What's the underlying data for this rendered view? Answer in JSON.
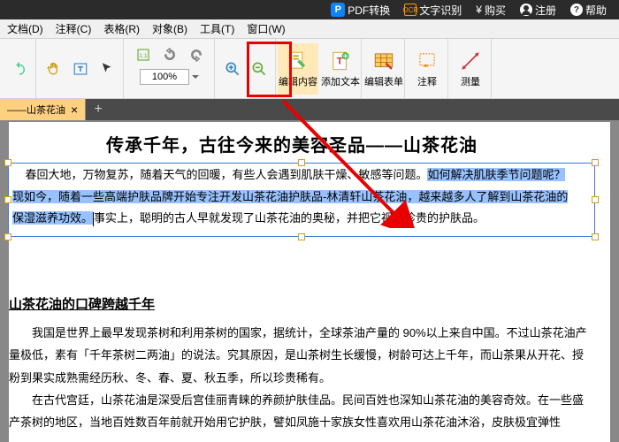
{
  "titlebar": {
    "pdf_convert": "PDF转换",
    "ocr": "文字识别",
    "buy": "购买",
    "register": "注册",
    "help": "帮助"
  },
  "menu": {
    "file": "文档(D)",
    "annotate": "注释(C)",
    "table": "表格(R)",
    "object": "对象(B)",
    "tool": "工具(T)",
    "window": "窗口(W)"
  },
  "toolbar": {
    "zoom": "100%",
    "edit_content": "编辑内容",
    "add_text": "添加文本",
    "edit_form": "编辑表单",
    "annotate": "注释",
    "measure": "测量"
  },
  "tab": {
    "name": "——山茶花油",
    "add": "+"
  },
  "doc": {
    "title": "传承千年，古往今来的美容圣品——山茶花油",
    "p1_a": "春回大地，万物复苏，随着天气的回暖，有些人会遇到肌肤干燥、敏感等问题。",
    "p1_q": "如何解决肌肤季节问题呢？",
    "p1_b": "现如今，随着一些高端护肤品牌开始专注开发山茶花油护肤品-林清轩山茶花油，越来越多人了解到山茶花油的",
    "p1_c": "保湿滋养功效。",
    "p1_d": "事实上，聪明的古人早就发现了山茶花油的奥秘，并把它视为珍贵的护肤品。",
    "h2": "山茶花油的口碑跨越千年",
    "p2": "我国是世界上最早发现茶树和利用茶树的国家，据统计，全球茶油产量的 90%以上来自中国。不过山茶花油产量极低，素有「千年茶树二两油」的说法。究其原因，是山茶树生长缓慢，树龄可达上千年，而山茶果从开花、授粉到果实成熟需经历秋、冬、春、夏、秋五季，所以珍贵稀有。",
    "p3": "在古代宫廷，山茶花油是深受后宫佳丽青睐的养颜护肤佳品。民间百姓也深知山茶花油的美容奇效。在一些盛产茶树的地区，当地百姓数百年前就开始用它护肤，譬如凤施十家族女性喜欢用山茶花油沐浴，皮肤极宜弹性"
  }
}
